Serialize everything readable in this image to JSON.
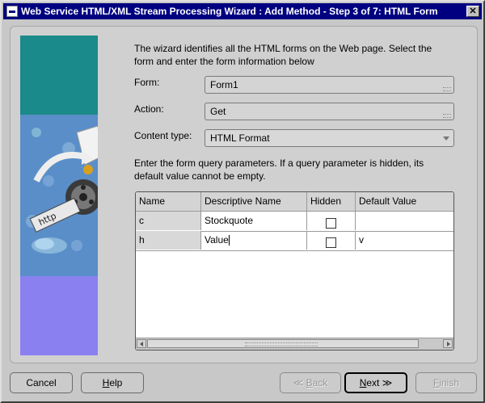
{
  "window": {
    "title": "Web Service HTML/XML Stream Processing Wizard : Add Method - Step 3 of 7: HTML Form",
    "close_label": "✕"
  },
  "intro_text": "The wizard identifies all the HTML forms on the Web page. Select the form and enter the form information below",
  "form": {
    "label": "Form:",
    "value": "Form1"
  },
  "action": {
    "label": "Action:",
    "value": "Get"
  },
  "content_type": {
    "label": "Content type:",
    "value": "HTML Format"
  },
  "query_text": "Enter the form query parameters. If a query parameter is hidden, its default value cannot be empty.",
  "table": {
    "headers": [
      "Name",
      "Descriptive Name",
      "Hidden",
      "Default Value"
    ],
    "rows": [
      {
        "name": "c",
        "descriptive": "Stockquote",
        "hidden": false,
        "default": ""
      },
      {
        "name": "h",
        "descriptive": "Value",
        "hidden": false,
        "default": "v"
      }
    ]
  },
  "buttons": {
    "cancel": "Cancel",
    "help_mnemonic": "H",
    "help_rest": "elp",
    "back_arrow": "≪",
    "back_mnemonic": "B",
    "back_rest": "ack",
    "next_mnemonic": "N",
    "next_rest": "ext",
    "next_arrow": "≫",
    "finish_mnemonic": "F",
    "finish_rest": "inish"
  },
  "colors": {
    "titlebar": "#000080",
    "art_teal": "#1a8a8a",
    "art_purple": "#8a80f0"
  }
}
